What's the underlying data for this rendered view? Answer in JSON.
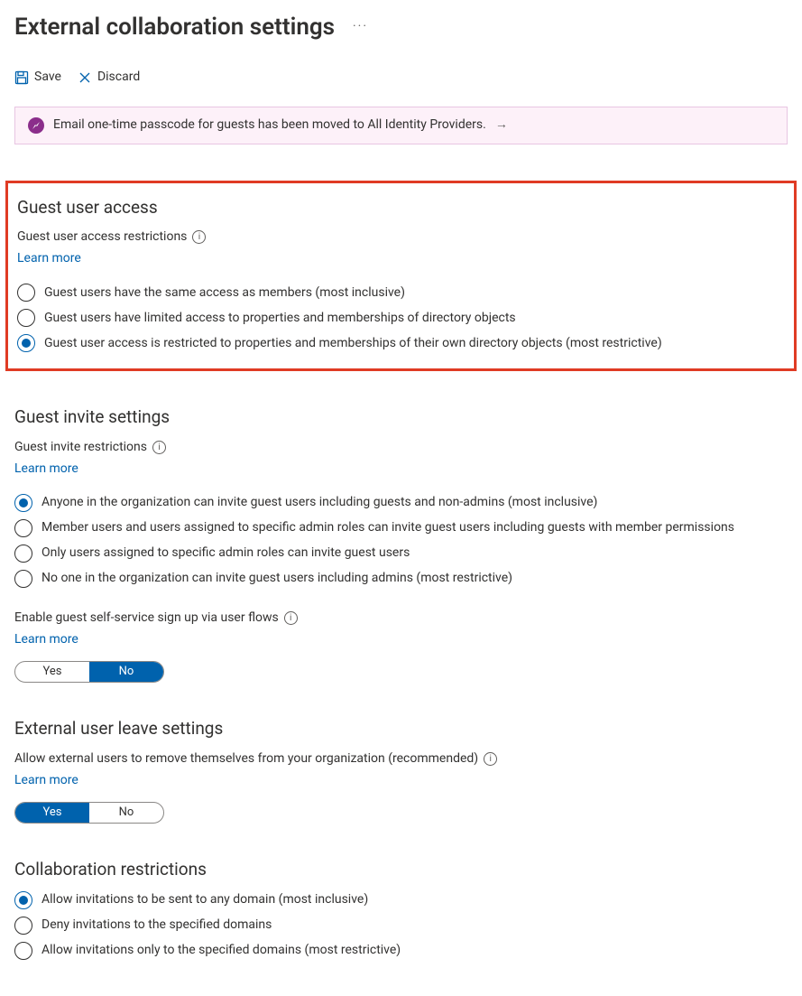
{
  "page_title": "External collaboration settings",
  "toolbar": {
    "save_label": "Save",
    "discard_label": "Discard"
  },
  "banner": {
    "text": "Email one-time passcode for guests has been moved to All Identity Providers."
  },
  "learn_more": "Learn more",
  "info_glyph": "i",
  "toggle_labels": {
    "yes": "Yes",
    "no": "No"
  },
  "sections": {
    "guest_access": {
      "heading": "Guest user access",
      "sublabel": "Guest user access restrictions",
      "options": [
        "Guest users have the same access as members (most inclusive)",
        "Guest users have limited access to properties and memberships of directory objects",
        "Guest user access is restricted to properties and memberships of their own directory objects (most restrictive)"
      ],
      "selected_index": 2
    },
    "guest_invite": {
      "heading": "Guest invite settings",
      "sublabel": "Guest invite restrictions",
      "options": [
        "Anyone in the organization can invite guest users including guests and non-admins (most inclusive)",
        "Member users and users assigned to specific admin roles can invite guest users including guests with member permissions",
        "Only users assigned to specific admin roles can invite guest users",
        "No one in the organization can invite guest users including admins (most restrictive)"
      ],
      "selected_index": 0,
      "self_service_label": "Enable guest self-service sign up via user flows",
      "self_service_value": "No"
    },
    "leave": {
      "heading": "External user leave settings",
      "sublabel": "Allow external users to remove themselves from your organization (recommended)",
      "value": "Yes"
    },
    "collab": {
      "heading": "Collaboration restrictions",
      "options": [
        "Allow invitations to be sent to any domain (most inclusive)",
        "Deny invitations to the specified domains",
        "Allow invitations only to the specified domains (most restrictive)"
      ],
      "selected_index": 0
    }
  }
}
